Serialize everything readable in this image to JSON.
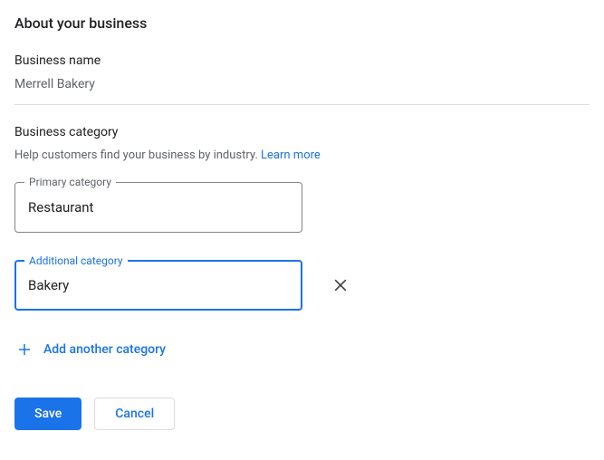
{
  "page_title": "About your business",
  "business_name": {
    "label": "Business name",
    "value": "Merrell Bakery"
  },
  "business_category": {
    "label": "Business category",
    "help_text": "Help customers find your business by industry. ",
    "learn_more": "Learn more"
  },
  "primary_category": {
    "label": "Primary category",
    "value": "Restaurant"
  },
  "additional_category": {
    "label": "Additional category",
    "value": "Bakery"
  },
  "add_another_label": "Add another category",
  "buttons": {
    "save": "Save",
    "cancel": "Cancel"
  }
}
